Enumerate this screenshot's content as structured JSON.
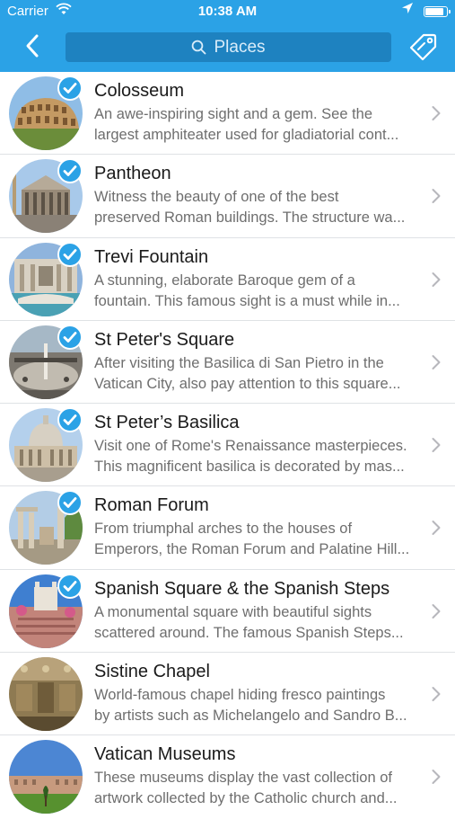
{
  "status_bar": {
    "carrier": "Carrier",
    "time": "10:38 AM",
    "battery_level": 0.9
  },
  "nav": {
    "search_label": "Places",
    "icons": [
      "back-chevron-icon",
      "search-icon",
      "tag-icon"
    ]
  },
  "colors": {
    "accent": "#2ba2e6",
    "search_bg": "#1e82c0",
    "text": "#1a1a1a",
    "subtext": "#6e6e6e"
  },
  "places": [
    {
      "title": "Colosseum",
      "line1": "An awe-inspiring sight and a gem. See the",
      "line2": "largest amphiteater used for gladiatorial cont...",
      "checked": true,
      "image": "colosseum"
    },
    {
      "title": "Pantheon",
      "line1": "Witness the beauty of one of the best",
      "line2": "preserved Roman buildings. The structure wa...",
      "checked": true,
      "image": "pantheon"
    },
    {
      "title": "Trevi Fountain",
      "line1": "A stunning, elaborate Baroque gem of a",
      "line2": "fountain. This famous sight is a must while in...",
      "checked": true,
      "image": "trevi"
    },
    {
      "title": "St Peter's Square",
      "line1": "After visiting the Basilica di San Pietro in the",
      "line2": "Vatican City, also pay attention to this square...",
      "checked": true,
      "image": "square"
    },
    {
      "title": "St Peter’s Basilica",
      "line1": "Visit one of Rome's Renaissance masterpieces.",
      "line2": "This magnificent basilica is decorated by mas...",
      "checked": true,
      "image": "basilica"
    },
    {
      "title": "Roman Forum",
      "line1": "From triumphal arches to the houses of",
      "line2": "Emperors, the Roman Forum and Palatine Hill...",
      "checked": true,
      "image": "forum"
    },
    {
      "title": "Spanish Square & the Spanish Steps",
      "line1": "A monumental square with beautiful sights",
      "line2": "scattered around. The famous Spanish Steps...",
      "checked": true,
      "image": "steps"
    },
    {
      "title": "Sistine Chapel",
      "line1": "World-famous chapel hiding fresco paintings",
      "line2": "by artists such as Michelangelo and Sandro B...",
      "checked": false,
      "image": "chapel"
    },
    {
      "title": "Vatican Museums",
      "line1": "These museums display the vast collection of",
      "line2": "artwork collected by the Catholic church and...",
      "checked": false,
      "image": "museums"
    }
  ]
}
